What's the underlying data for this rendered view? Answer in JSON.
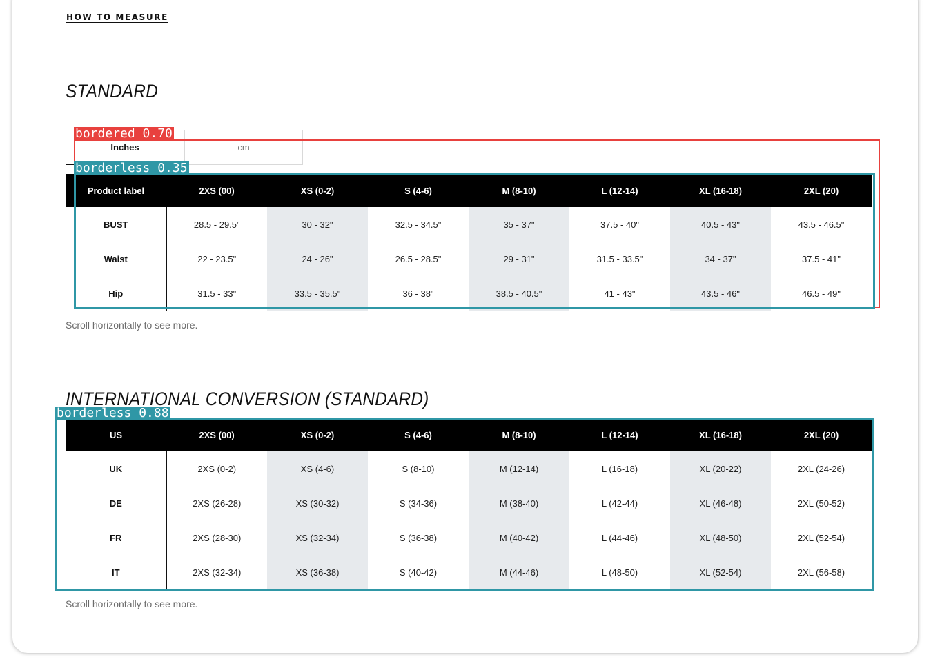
{
  "how_to_measure": "HOW TO MEASURE",
  "standard": {
    "title": "STANDARD",
    "unit_toggle": {
      "inches": "Inches",
      "cm": "cm",
      "selected": "Inches"
    },
    "headers": [
      "Product label",
      "2XS (00)",
      "XS (0-2)",
      "S (4-6)",
      "M (8-10)",
      "L (12-14)",
      "XL (16-18)",
      "2XL (20)"
    ],
    "rows": [
      [
        "BUST",
        "28.5 - 29.5\"",
        "30 - 32\"",
        "32.5 - 34.5\"",
        "35 - 37\"",
        "37.5 - 40\"",
        "40.5 - 43\"",
        "43.5 - 46.5\""
      ],
      [
        "Waist",
        "22 - 23.5\"",
        "24 - 26\"",
        "26.5 - 28.5\"",
        "29 - 31\"",
        "31.5 - 33.5\"",
        "34 - 37\"",
        "37.5 - 41\""
      ],
      [
        "Hip",
        "31.5 - 33\"",
        "33.5 - 35.5\"",
        "36 - 38\"",
        "38.5 - 40.5\"",
        "41 - 43\"",
        "43.5 - 46\"",
        "46.5 - 49\""
      ]
    ],
    "scroll_note": "Scroll horizontally to see more."
  },
  "international": {
    "title": "INTERNATIONAL CONVERSION (STANDARD)",
    "headers": [
      "US",
      "2XS (00)",
      "XS (0-2)",
      "S (4-6)",
      "M (8-10)",
      "L (12-14)",
      "XL (16-18)",
      "2XL (20)"
    ],
    "rows": [
      [
        "UK",
        "2XS (0-2)",
        "XS (4-6)",
        "S (8-10)",
        "M (12-14)",
        "L (16-18)",
        "XL (20-22)",
        "2XL (24-26)"
      ],
      [
        "DE",
        "2XS (26-28)",
        "XS (30-32)",
        "S (34-36)",
        "M (38-40)",
        "L (42-44)",
        "XL (46-48)",
        "2XL (50-52)"
      ],
      [
        "FR",
        "2XS (28-30)",
        "XS (32-34)",
        "S (36-38)",
        "M (40-42)",
        "L (44-46)",
        "XL (48-50)",
        "2XL (52-54)"
      ],
      [
        "IT",
        "2XS (32-34)",
        "XS (36-38)",
        "S (40-42)",
        "M (44-46)",
        "L (48-50)",
        "XL (52-54)",
        "2XL (56-58)"
      ]
    ],
    "scroll_note": "Scroll horizontally to see more."
  },
  "detections": [
    {
      "label": "bordered 0.70",
      "color": "#e8413e"
    },
    {
      "label": "borderless 0.35",
      "color": "#2f97a6"
    },
    {
      "label": "borderless 0.88",
      "color": "#2f97a6"
    }
  ]
}
